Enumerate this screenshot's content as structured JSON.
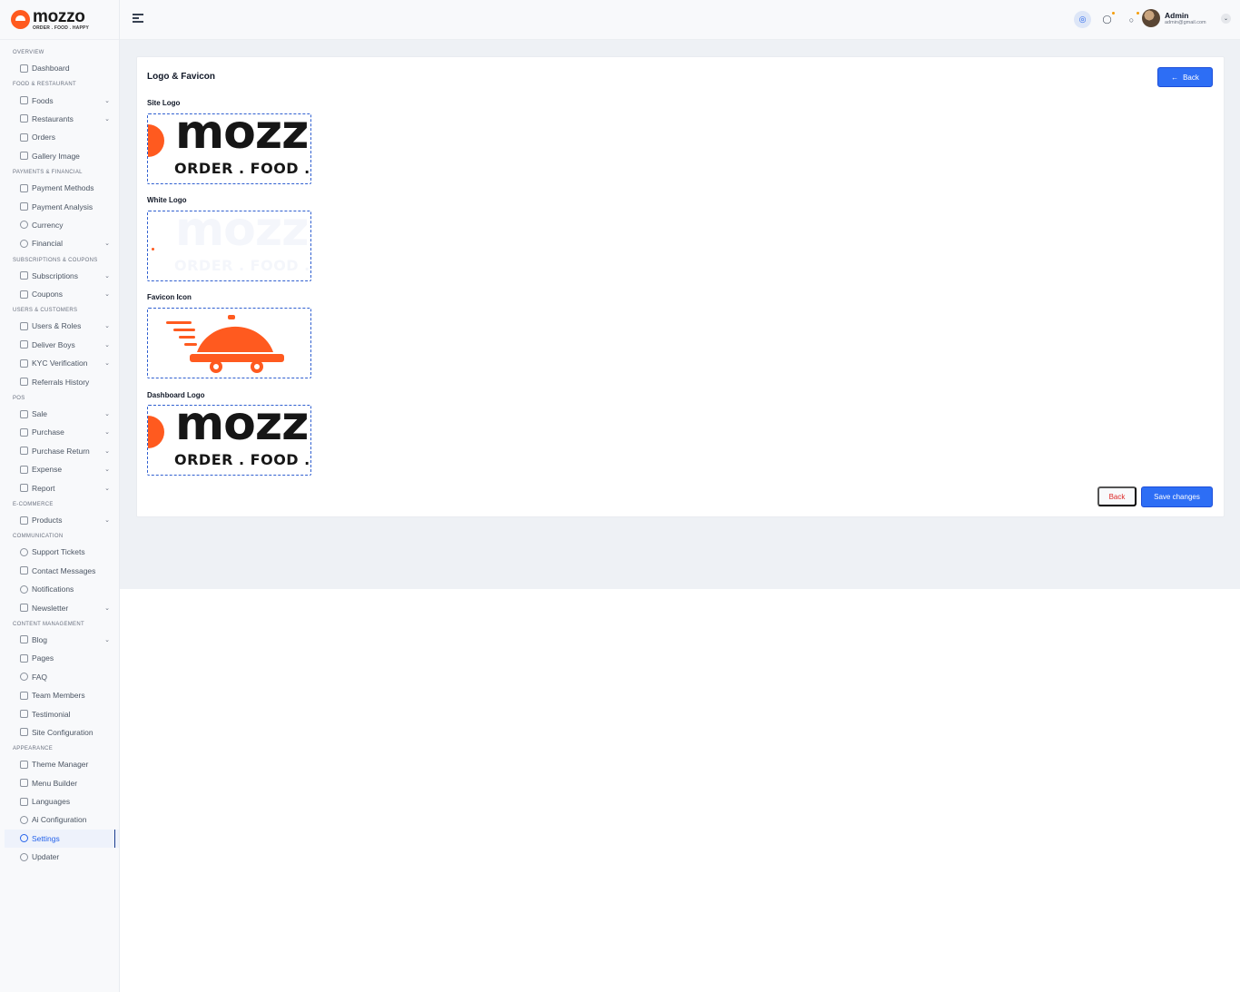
{
  "brand": {
    "name": "mozzo",
    "tagline": "ORDER . FOOD . HAPPY",
    "accent": "#ff5a1f"
  },
  "sidebar": {
    "sections": [
      {
        "title": "OVERVIEW",
        "items": [
          {
            "label": "Dashboard",
            "icon": "home-icon",
            "has_children": false
          }
        ]
      },
      {
        "title": "FOOD & RESTAURANT",
        "items": [
          {
            "label": "Foods",
            "icon": "food-icon",
            "has_children": true
          },
          {
            "label": "Restaurants",
            "icon": "restaurant-icon",
            "has_children": true
          },
          {
            "label": "Orders",
            "icon": "orders-icon",
            "has_children": false
          },
          {
            "label": "Gallery Image",
            "icon": "image-icon",
            "has_children": false
          }
        ]
      },
      {
        "title": "PAYMENTS & FINANCIAL",
        "items": [
          {
            "label": "Payment Methods",
            "icon": "card-icon",
            "has_children": false
          },
          {
            "label": "Payment Analysis",
            "icon": "analysis-icon",
            "has_children": false
          },
          {
            "label": "Currency",
            "icon": "currency-icon",
            "has_children": false
          },
          {
            "label": "Financial",
            "icon": "dollar-icon",
            "has_children": true
          }
        ]
      },
      {
        "title": "SUBSCRIPTIONS & COUPONS",
        "items": [
          {
            "label": "Subscriptions",
            "icon": "subscription-icon",
            "has_children": true
          },
          {
            "label": "Coupons",
            "icon": "gift-icon",
            "has_children": true
          }
        ]
      },
      {
        "title": "USERS & CUSTOMERS",
        "items": [
          {
            "label": "Users & Roles",
            "icon": "users-icon",
            "has_children": true
          },
          {
            "label": "Deliver Boys",
            "icon": "bike-icon",
            "has_children": true
          },
          {
            "label": "KYC Verification",
            "icon": "user-check-icon",
            "has_children": true
          },
          {
            "label": "Referrals History",
            "icon": "referral-icon",
            "has_children": false
          }
        ]
      },
      {
        "title": "POS",
        "items": [
          {
            "label": "Sale",
            "icon": "sale-icon",
            "has_children": true
          },
          {
            "label": "Purchase",
            "icon": "purchase-icon",
            "has_children": true
          },
          {
            "label": "Purchase Return",
            "icon": "return-icon",
            "has_children": true
          },
          {
            "label": "Expense",
            "icon": "expense-icon",
            "has_children": true
          },
          {
            "label": "Report",
            "icon": "report-icon",
            "has_children": true
          }
        ]
      },
      {
        "title": "E-COMMERCE",
        "items": [
          {
            "label": "Products",
            "icon": "box-icon",
            "has_children": true
          }
        ]
      },
      {
        "title": "COMMUNICATION",
        "items": [
          {
            "label": "Support Tickets",
            "icon": "support-icon",
            "has_children": false
          },
          {
            "label": "Contact Messages",
            "icon": "mail-icon",
            "has_children": false
          },
          {
            "label": "Notifications",
            "icon": "bell-icon",
            "has_children": false
          },
          {
            "label": "Newsletter",
            "icon": "newsletter-icon",
            "has_children": true
          }
        ]
      },
      {
        "title": "CONTENT MANAGEMENT",
        "items": [
          {
            "label": "Blog",
            "icon": "blog-icon",
            "has_children": true
          },
          {
            "label": "Pages",
            "icon": "page-icon",
            "has_children": false
          },
          {
            "label": "FAQ",
            "icon": "faq-icon",
            "has_children": false
          },
          {
            "label": "Team Members",
            "icon": "team-icon",
            "has_children": false
          },
          {
            "label": "Testimonial",
            "icon": "testimonial-icon",
            "has_children": false
          },
          {
            "label": "Site Configuration",
            "icon": "config-icon",
            "has_children": false
          }
        ]
      },
      {
        "title": "APPEARANCE",
        "items": [
          {
            "label": "Theme Manager",
            "icon": "theme-icon",
            "has_children": false
          },
          {
            "label": "Menu Builder",
            "icon": "menu-icon",
            "has_children": false
          },
          {
            "label": "Languages",
            "icon": "language-icon",
            "has_children": false
          },
          {
            "label": "Ai Configuration",
            "icon": "ai-icon",
            "has_children": false
          },
          {
            "label": "Settings",
            "icon": "gear-icon",
            "has_children": false,
            "active": true
          },
          {
            "label": "Updater",
            "icon": "update-icon",
            "has_children": false
          }
        ]
      }
    ]
  },
  "topbar": {
    "user": {
      "name": "Admin",
      "email": "admin@gmail.com"
    }
  },
  "card": {
    "title": "Logo & Favicon",
    "back_top_label": "Back",
    "fields": [
      {
        "label": "Site Logo"
      },
      {
        "label": "White Logo"
      },
      {
        "label": "Favicon Icon"
      },
      {
        "label": "Dashboard Logo"
      }
    ],
    "back_label": "Back",
    "save_label": "Save changes"
  },
  "colors": {
    "primary": "#2d6ef5",
    "danger": "#dc2626",
    "sidebar_bg": "#f8f9fb",
    "main_bg": "#eef1f5"
  }
}
